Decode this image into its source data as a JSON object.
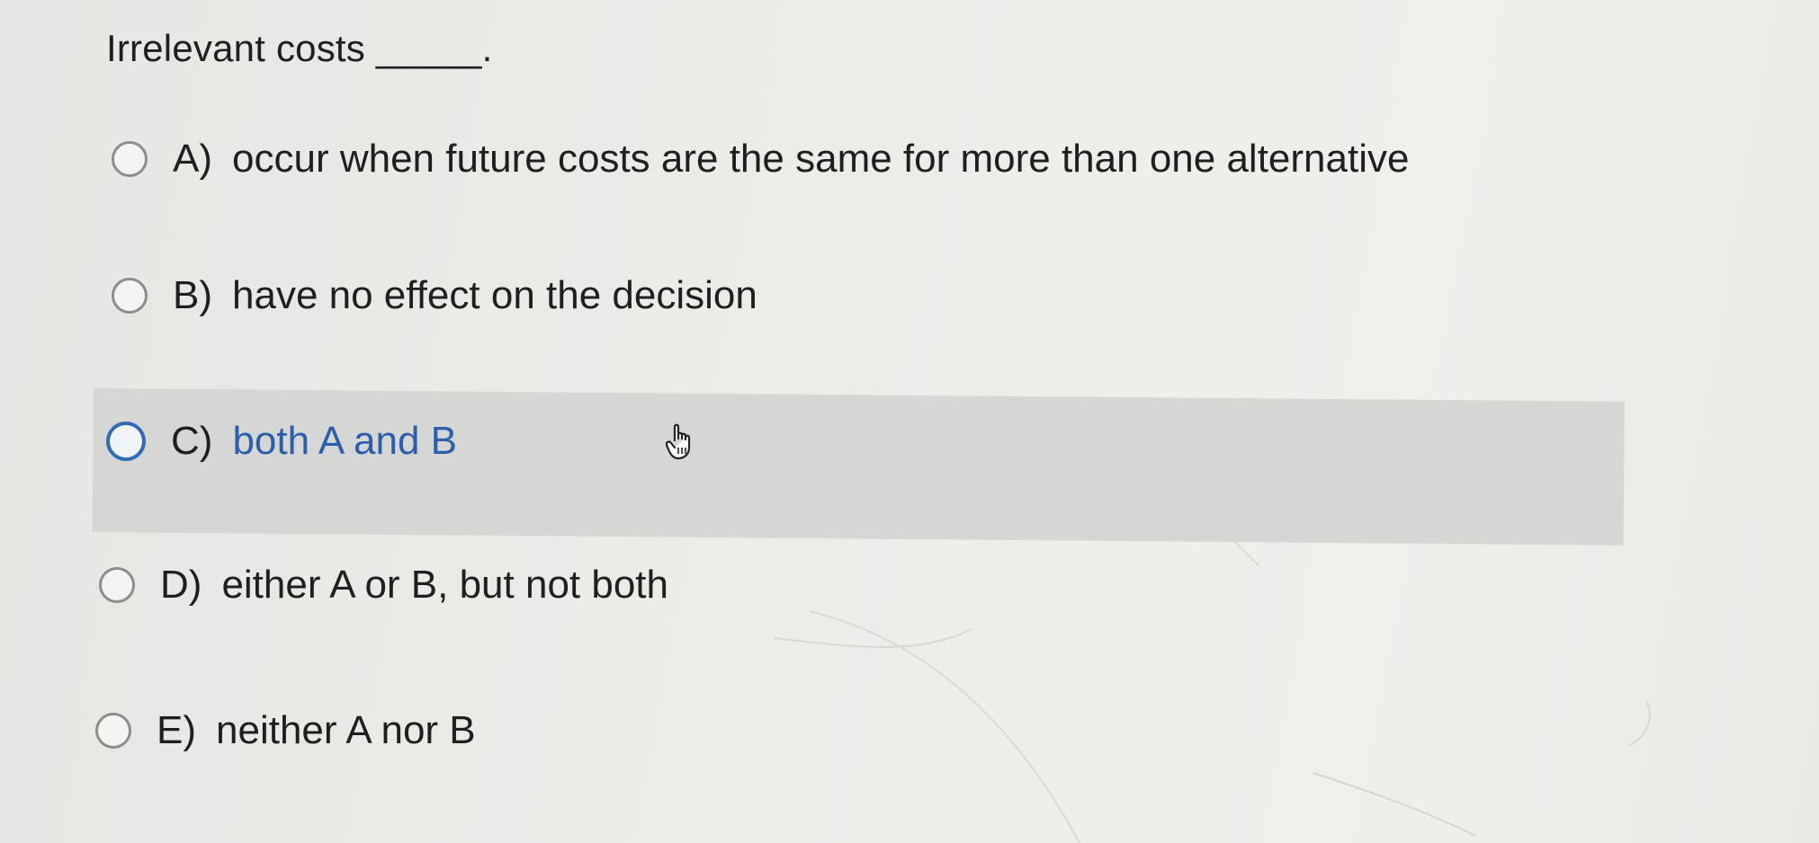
{
  "question": {
    "text": "Irrelevant costs _____."
  },
  "options": [
    {
      "letter": "A)",
      "text": "occur when future costs are the same for more than one alternative",
      "selected": false
    },
    {
      "letter": "B)",
      "text": "have no effect on the decision",
      "selected": false
    },
    {
      "letter": "C)",
      "text": "both A and B",
      "selected": false,
      "hovered": true
    },
    {
      "letter": "D)",
      "text": "either A or B, but not both",
      "selected": false
    },
    {
      "letter": "E)",
      "text": "neither A nor B",
      "selected": false
    }
  ],
  "colors": {
    "accent": "#2e6bb8",
    "hover_row": "#d6d6d4",
    "text": "#1f1f1f"
  },
  "icons": {
    "cursor": "hand-pointer-icon",
    "radio": "radio-button-icon"
  }
}
